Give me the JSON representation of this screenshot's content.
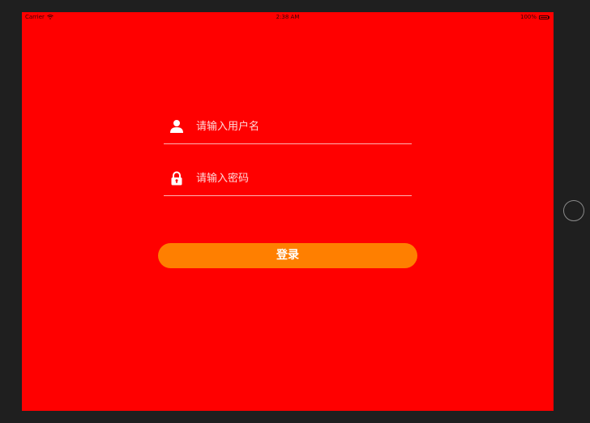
{
  "status_bar": {
    "carrier": "Carrier",
    "time": "2:38 AM",
    "battery_text": "100%",
    "wifi_icon": "wifi-icon",
    "battery_icon": "battery-icon"
  },
  "login_form": {
    "username": {
      "icon": "user-icon",
      "placeholder": "请输入用户名",
      "value": ""
    },
    "password": {
      "icon": "lock-icon",
      "placeholder": "请输入密码",
      "value": ""
    },
    "submit_label": "登录"
  },
  "colors": {
    "background": "#ff0000",
    "button": "#ff7f00",
    "text": "#ffffff"
  }
}
